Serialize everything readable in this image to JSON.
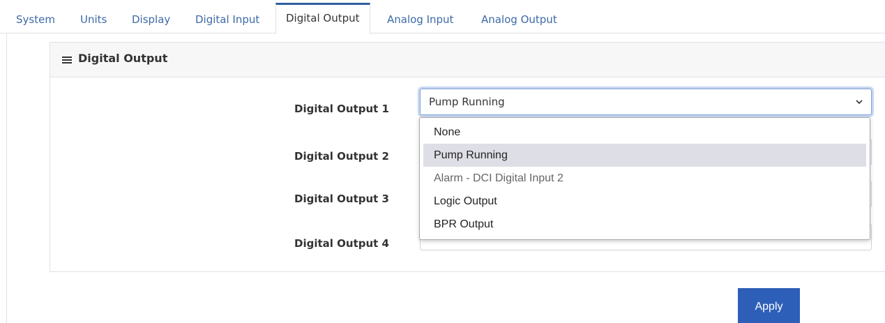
{
  "tabs": [
    {
      "label": "System",
      "active": false
    },
    {
      "label": "Units",
      "active": false
    },
    {
      "label": "Display",
      "active": false
    },
    {
      "label": "Digital Input",
      "active": false
    },
    {
      "label": "Digital Output",
      "active": true
    },
    {
      "label": "Analog Input",
      "active": false
    },
    {
      "label": "Analog Output",
      "active": false
    }
  ],
  "card": {
    "title": "Digital Output",
    "icon": "hamburger-menu-icon"
  },
  "rows": [
    {
      "label": "Digital Output 1",
      "value": "Pump Running"
    },
    {
      "label": "Digital Output 2",
      "value": ""
    },
    {
      "label": "Digital Output 3",
      "value": ""
    },
    {
      "label": "Digital Output 4",
      "value": ""
    }
  ],
  "dropdown": {
    "options": [
      {
        "label": "None",
        "state": "normal"
      },
      {
        "label": "Pump Running",
        "state": "selected"
      },
      {
        "label": "Alarm - DCI Digital Input 2",
        "state": "disabled"
      },
      {
        "label": "Logic Output",
        "state": "normal"
      },
      {
        "label": "BPR Output",
        "state": "normal"
      }
    ]
  },
  "apply_label": "Apply",
  "colors": {
    "tab_link": "#3d6aa6",
    "accent": "#2f5f9e",
    "apply_bg": "#2e5fb8",
    "selected_option_bg": "#dedee6"
  }
}
